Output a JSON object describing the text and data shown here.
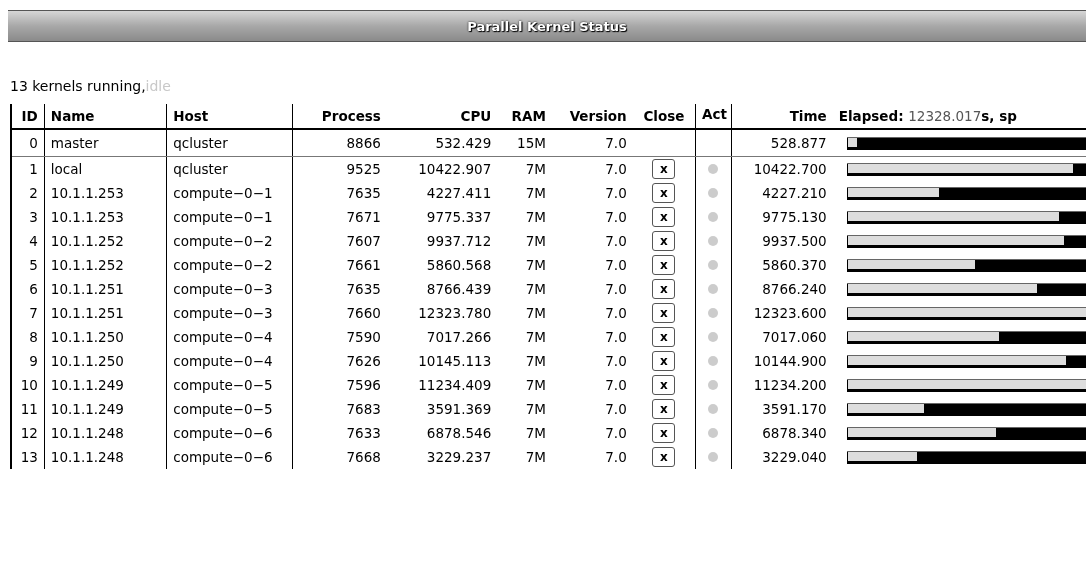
{
  "window": {
    "title": "Parallel Kernel Status"
  },
  "status": {
    "running": "13 kernels running,",
    "idle": "idle"
  },
  "table": {
    "columns": [
      "ID",
      "Name",
      "Host",
      "Process",
      "CPU",
      "RAM",
      "Version",
      "Close",
      "Act",
      "Time"
    ],
    "elapsed": {
      "label": "Elapsed:",
      "value": "12328.017",
      "suffix": "s, sp"
    },
    "rows": [
      {
        "kind": "master",
        "id": "0",
        "name": "master",
        "host": "qcluster",
        "process": "8866",
        "cpu": "532.429",
        "ram": "15M",
        "version": "7.0",
        "time": "528.877",
        "level": 0.04
      },
      {
        "kind": "worker",
        "id": "1",
        "name": "local",
        "host": "qcluster",
        "process": "9525",
        "cpu": "10422.907",
        "ram": "7M",
        "version": "7.0",
        "close": "x",
        "time": "10422.700",
        "level": 0.94
      },
      {
        "kind": "worker",
        "id": "2",
        "name": "10.1.1.253",
        "host": "compute−0−1",
        "process": "7635",
        "cpu": "4227.411",
        "ram": "7M",
        "version": "7.0",
        "close": "x",
        "time": "4227.210",
        "level": 0.38
      },
      {
        "kind": "worker",
        "id": "3",
        "name": "10.1.1.253",
        "host": "compute−0−1",
        "process": "7671",
        "cpu": "9775.337",
        "ram": "7M",
        "version": "7.0",
        "close": "x",
        "time": "9775.130",
        "level": 0.88
      },
      {
        "kind": "worker",
        "id": "4",
        "name": "10.1.1.252",
        "host": "compute−0−2",
        "process": "7607",
        "cpu": "9937.712",
        "ram": "7M",
        "version": "7.0",
        "close": "x",
        "time": "9937.500",
        "level": 0.9
      },
      {
        "kind": "worker",
        "id": "5",
        "name": "10.1.1.252",
        "host": "compute−0−2",
        "process": "7661",
        "cpu": "5860.568",
        "ram": "7M",
        "version": "7.0",
        "close": "x",
        "time": "5860.370",
        "level": 0.53
      },
      {
        "kind": "worker",
        "id": "6",
        "name": "10.1.1.251",
        "host": "compute−0−3",
        "process": "7635",
        "cpu": "8766.439",
        "ram": "7M",
        "version": "7.0",
        "close": "x",
        "time": "8766.240",
        "level": 0.79
      },
      {
        "kind": "worker",
        "id": "7",
        "name": "10.1.1.251",
        "host": "compute−0−3",
        "process": "7660",
        "cpu": "12323.780",
        "ram": "7M",
        "version": "7.0",
        "close": "x",
        "time": "12323.600",
        "level": 1.0
      },
      {
        "kind": "worker",
        "id": "8",
        "name": "10.1.1.250",
        "host": "compute−0−4",
        "process": "7590",
        "cpu": "7017.266",
        "ram": "7M",
        "version": "7.0",
        "close": "x",
        "time": "7017.060",
        "level": 0.63
      },
      {
        "kind": "worker",
        "id": "9",
        "name": "10.1.1.250",
        "host": "compute−0−4",
        "process": "7626",
        "cpu": "10145.113",
        "ram": "7M",
        "version": "7.0",
        "close": "x",
        "time": "10144.900",
        "level": 0.91
      },
      {
        "kind": "worker",
        "id": "10",
        "name": "10.1.1.249",
        "host": "compute−0−5",
        "process": "7596",
        "cpu": "11234.409",
        "ram": "7M",
        "version": "7.0",
        "close": "x",
        "time": "11234.200",
        "level": 1.0
      },
      {
        "kind": "worker",
        "id": "11",
        "name": "10.1.1.249",
        "host": "compute−0−5",
        "process": "7683",
        "cpu": "3591.369",
        "ram": "7M",
        "version": "7.0",
        "close": "x",
        "time": "3591.170",
        "level": 0.32
      },
      {
        "kind": "worker",
        "id": "12",
        "name": "10.1.1.248",
        "host": "compute−0−6",
        "process": "7633",
        "cpu": "6878.546",
        "ram": "7M",
        "version": "7.0",
        "close": "x",
        "time": "6878.340",
        "level": 0.62
      },
      {
        "kind": "worker",
        "id": "13",
        "name": "10.1.1.248",
        "host": "compute−0−6",
        "process": "7668",
        "cpu": "3229.237",
        "ram": "7M",
        "version": "7.0",
        "close": "x",
        "time": "3229.040",
        "level": 0.29
      }
    ]
  }
}
